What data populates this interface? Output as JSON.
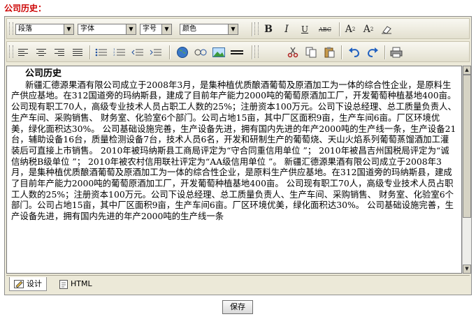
{
  "section_label": "公司历史：",
  "toolbar": {
    "paragraph_select": "段落",
    "font_select": "字体",
    "size_select": "字号",
    "color_select": "颜色",
    "bold_label": "B",
    "italic_label": "I",
    "underline_label": "U",
    "strike_label": "ABC",
    "superscript_label": "A",
    "subscript_label": "A",
    "sup_mark": "2",
    "sub_mark": "2"
  },
  "content": {
    "title": "公司历史",
    "body": "新疆汇德源果酒有限公司成立于2008年3月，是集种植优质酿酒葡萄及原酒加工为一体的综合性企业，是原料生产供应基地。在312国道旁的玛纳斯县，建成了目前年产能力2000吨的葡萄原酒加工厂，开发葡萄种植基地400亩。 公司现有职工70人，高级专业技术人员占职工人数的25%；注册资本100万元。公司下设总经理、总工质量负责人、生产车间、采购销售、 财务室、化验室6个部门。公司占地15亩，其中厂区面积9亩，生产车间6亩。厂区环境优美，绿化面积达30%。 公司基础设施完善，生产设备先进，拥有国内先进的年产2000吨的生产线一条，生产设备21台，辅助设备16台，质量检测设备7台，技术人员6名，开发和研制生产的葡萄烧、天山火焰系列葡萄蒸馏酒加工灌装后可直接上市销售。 2010年被玛纳斯县工商局评定为“守合同重信用单位 ”； 2010年被昌吉州国税局评定为“诚信纳税B级单位 ”； 2010年被农村信用联社评定为“AA级信用单位 ”。 新疆汇德源果酒有限公司成立于2008年3月，是集种植优质酿酒葡萄及原酒加工为一体的综合性企业，是原料生产供应基地。在312国道旁的玛纳斯县，建成了目前年产能力2000吨的葡萄原酒加工厂，开发葡萄种植基地400亩。 公司现有职工70人，高级专业技术人员占职工人数的25%；注册资本100万元。公司下设总经理、总工质量负责人、生产车间、采购销售、 财务室、化验室6个部门。公司占地15亩，其中厂区面积9亩，生产车间6亩。厂区环境优美，绿化面积达30%。 公司基础设施完善，生产设备先进，拥有国内先进的年产2000吨的生产线一条"
  },
  "tabs": {
    "design": "设计",
    "html": "HTML"
  },
  "save_label": "保存",
  "colors": {
    "label_red": "#cc0000",
    "toolbar_bg": "#ece9d8"
  }
}
